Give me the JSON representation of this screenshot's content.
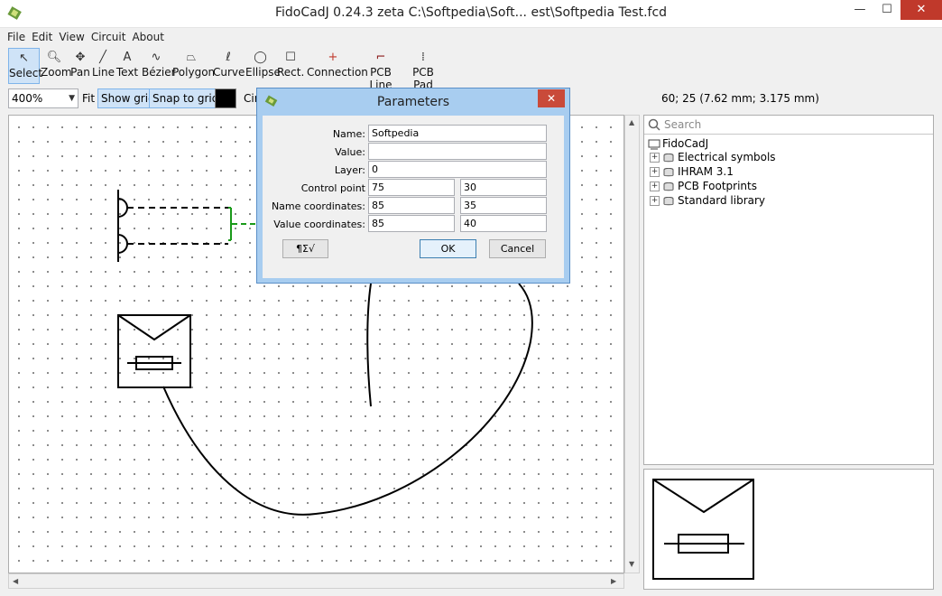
{
  "window": {
    "title": "FidoCadJ 0.24.3 zeta C:\\Softpedia\\Soft...  est\\Softpedia Test.fcd",
    "minimize": "—",
    "maximize": "☐",
    "close": "✕"
  },
  "menu": [
    "File",
    "Edit",
    "View",
    "Circuit",
    "About"
  ],
  "toolbar": [
    {
      "label": "Select",
      "icon": "arrow-icon",
      "glyph": "↖"
    },
    {
      "label": "Zoom",
      "icon": "magnifier-icon",
      "glyph": "🔍︎"
    },
    {
      "label": "Pan",
      "icon": "pan-icon",
      "glyph": "✥"
    },
    {
      "label": "Line",
      "icon": "line-icon",
      "glyph": "╱"
    },
    {
      "label": "Text",
      "icon": "text-icon",
      "glyph": "A"
    },
    {
      "label": "Bézier",
      "icon": "bezier-icon",
      "glyph": "∿"
    },
    {
      "label": "Polygon",
      "icon": "polygon-icon",
      "glyph": "⏢"
    },
    {
      "label": "Curve",
      "icon": "curve-icon",
      "glyph": "ℓ"
    },
    {
      "label": "Ellipse",
      "icon": "ellipse-icon",
      "glyph": "◯"
    },
    {
      "label": "Rect.",
      "icon": "rect-icon",
      "glyph": "☐"
    },
    {
      "label": "Connection",
      "icon": "connection-icon",
      "glyph": "+"
    },
    {
      "label": "PCB Line",
      "icon": "pcb-line-icon",
      "glyph": "⌐"
    },
    {
      "label": "PCB Pad",
      "icon": "pcb-pad-icon",
      "glyph": "⁞"
    }
  ],
  "options": {
    "zoom": "400%",
    "fit": "Fit",
    "show_grid": "Show grid",
    "snap_to_grid": "Snap to grid",
    "layer_partial": "Cir",
    "coordinates": "60; 25 (7.62 mm; 3.175 mm)"
  },
  "library": {
    "search_placeholder": "Search",
    "root": "FidoCadJ",
    "items": [
      "Electrical symbols",
      "IHRAM 3.1",
      "PCB Footprints",
      "Standard library"
    ]
  },
  "dialog": {
    "title": "Parameters",
    "close": "✕",
    "labels": {
      "name": "Name:",
      "value": "Value:",
      "layer": "Layer:",
      "control_point": "Control point",
      "name_coordinates": "Name coordinates:",
      "value_coordinates": "Value coordinates:"
    },
    "values": {
      "name": "Softpedia",
      "value": "",
      "layer": "0",
      "control_x": "75",
      "control_y": "30",
      "name_x": "85",
      "name_y": "35",
      "value_x": "85",
      "value_y": "40"
    },
    "symbols_button": "¶Σ√",
    "ok": "OK",
    "cancel": "Cancel"
  },
  "colors": {
    "selected_tool": "#cfe3f7",
    "dialog_frame": "#a8cdf0",
    "close_button": "#c94a3a",
    "connection_green": "#1a9a1a"
  }
}
